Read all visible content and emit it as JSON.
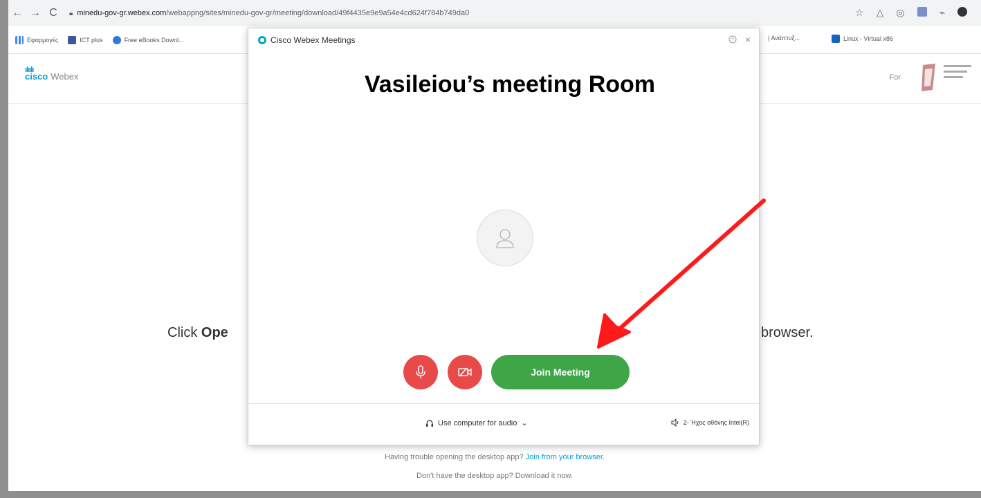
{
  "browser": {
    "url_host": "minedu-gov-gr.webex.com",
    "url_path": "/webappng/sites/minedu-gov-gr/meeting/download/49f4435e9e9a54e4cd624f784b749da0",
    "bookmarks": [
      "Εφαρμογές",
      "ICT plus",
      "Free eBooks Downl..."
    ],
    "bookmarks_right": [
      "| Ανάπτυξ...",
      "Linux - Virtual x86"
    ]
  },
  "page": {
    "brand_cisco": "cisco",
    "brand_webex": "Webex",
    "for_label": "For",
    "click_prefix": "Click ",
    "click_bold": "Ope",
    "browser_suffix": "browser.",
    "trouble_text": "Having trouble opening the desktop app? ",
    "trouble_link": "Join from your browser",
    "trouble_end": ".",
    "no_desktop": "Don't have the desktop app? Download it now."
  },
  "dialog": {
    "title": "Cisco Webex Meetings",
    "help": "?",
    "close": "×",
    "room_name": "Vasileiou’s meeting Room",
    "join_label": "Join Meeting",
    "audio_label": "Use computer for audio",
    "speaker_label": "2- Ήχος οθόνης Intel(R)"
  },
  "colors": {
    "mute_red": "#e84a4a",
    "join_green": "#3fa648",
    "cisco_blue": "#049fd9",
    "annotation_red": "#ff0000"
  },
  "icons": [
    "back-icon",
    "forward-icon",
    "reload-icon",
    "lock-icon",
    "star-icon",
    "microphone-muted-icon",
    "video-off-icon",
    "headset-icon",
    "speaker-icon",
    "avatar-icon",
    "webex-logo-icon"
  ]
}
